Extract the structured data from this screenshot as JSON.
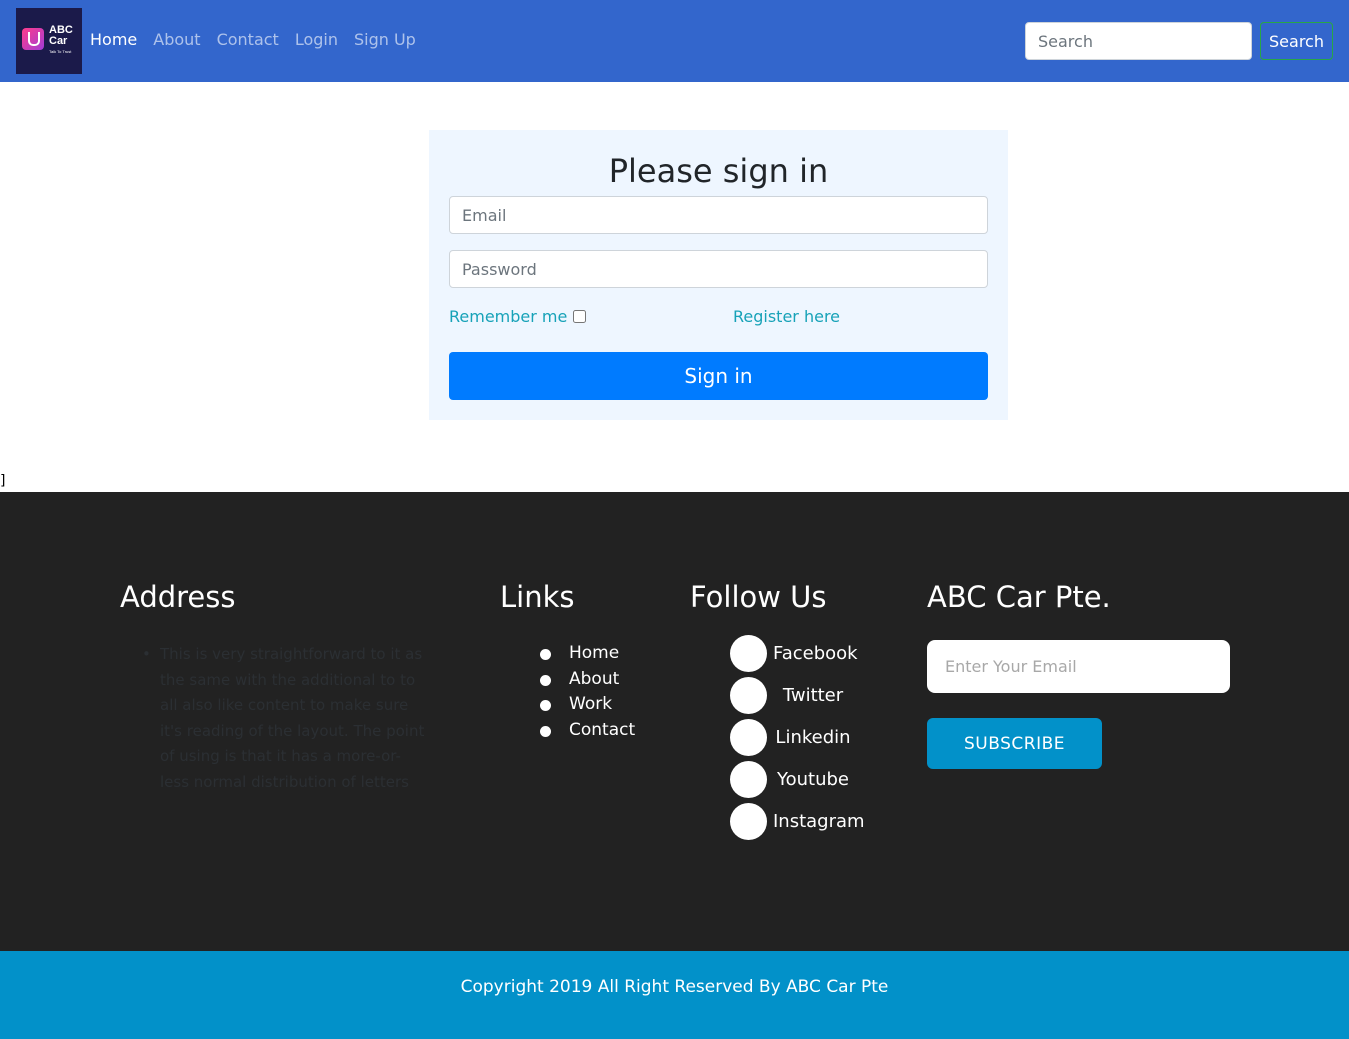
{
  "brand": {
    "name": "ABC Car",
    "tagline": "Talk To Trust"
  },
  "nav": {
    "items": [
      {
        "label": "Home",
        "active": true
      },
      {
        "label": "About",
        "active": false
      },
      {
        "label": "Contact",
        "active": false
      },
      {
        "label": "Login",
        "active": false
      },
      {
        "label": "Sign Up",
        "active": false
      }
    ],
    "search_placeholder": "Search",
    "search_button": "Search"
  },
  "signin": {
    "title": "Please sign in",
    "email_placeholder": "Email",
    "password_placeholder": "Password",
    "remember_label": "Remember me",
    "remember_checked": false,
    "register_link": "Register here",
    "submit_label": "Sign in"
  },
  "stray_text": "]",
  "footer": {
    "address_heading": "Address",
    "address_text": "This is very straightforward to it as the same with the additional to to all also like content to make sure it's reading of the layout. The point of using is that it has a more-or-less normal distribution of letters",
    "links_heading": "Links",
    "links": [
      "Home",
      "About",
      "Work",
      "Contact"
    ],
    "follow_heading": "Follow Us",
    "follow": [
      "Facebook",
      "Twitter",
      "Linkedin",
      "Youtube",
      "Instagram"
    ],
    "company_heading": "ABC Car Pte.",
    "newsletter_placeholder": "Enter Your Email",
    "subscribe_label": "SUBSCRIBE"
  },
  "copyright": "Copyright 2019 All Right Reserved By ABC Car Pte",
  "colors": {
    "navbar": "#3366cc",
    "signin_card": "#eef6ff",
    "primary": "#007bff",
    "link_teal": "#17a2b8",
    "footer": "#222222",
    "accent_blue": "#0291c9"
  }
}
